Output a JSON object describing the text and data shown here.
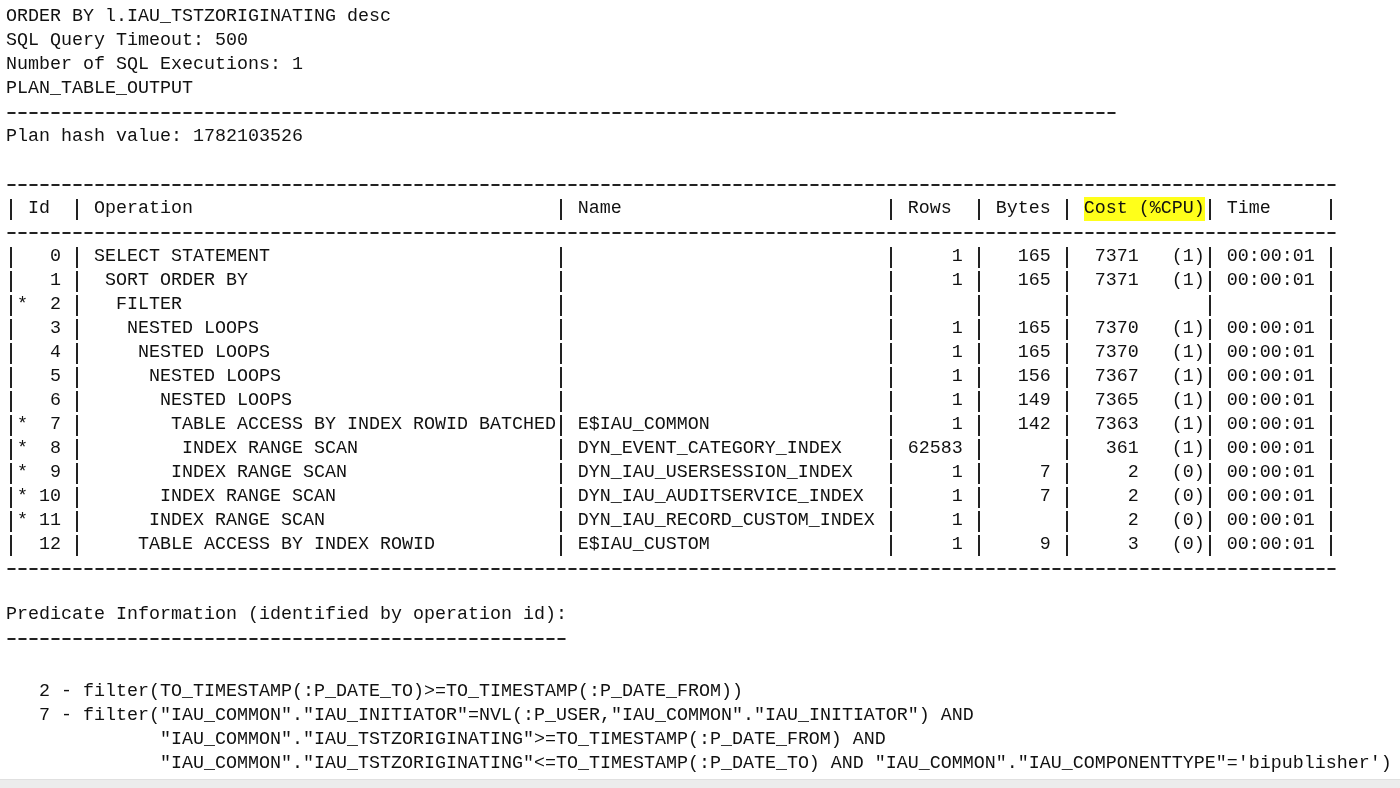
{
  "preamble": [
    "ORDER BY l.IAU_TSTZORIGINATING desc",
    "SQL Query Timeout: 500",
    "Number of SQL Executions: 1",
    "PLAN_TABLE_OUTPUT"
  ],
  "plan_hash": "Plan hash value: 1782103526",
  "plan_table": {
    "columns": [
      {
        "label": "Id",
        "highlighted": false
      },
      {
        "label": "Operation",
        "highlighted": false
      },
      {
        "label": "Name",
        "highlighted": false
      },
      {
        "label": "Rows",
        "highlighted": false
      },
      {
        "label": "Bytes",
        "highlighted": false
      },
      {
        "label": "Cost (%CPU)",
        "highlighted": true
      },
      {
        "label": "Time",
        "highlighted": false
      }
    ],
    "rows": [
      {
        "id": "0",
        "operation": "SELECT STATEMENT",
        "rows": "1",
        "bytes": "165",
        "cost": "7371",
        "cpu": "(1)",
        "time": "00:00:01",
        "children": [
          {
            "id": "1",
            "operation": "SORT ORDER BY",
            "rows": "1",
            "bytes": "165",
            "cost": "7371",
            "cpu": "(1)",
            "time": "00:00:01",
            "children": [
              {
                "id": "2",
                "flag": "*",
                "operation": "FILTER",
                "children": [
                  {
                    "id": "3",
                    "operation": "NESTED LOOPS",
                    "rows": "1",
                    "bytes": "165",
                    "cost": "7370",
                    "cpu": "(1)",
                    "time": "00:00:01",
                    "children": [
                      {
                        "id": "4",
                        "operation": "NESTED LOOPS",
                        "rows": "1",
                        "bytes": "165",
                        "cost": "7370",
                        "cpu": "(1)",
                        "time": "00:00:01",
                        "children": [
                          {
                            "id": "5",
                            "operation": "NESTED LOOPS",
                            "rows": "1",
                            "bytes": "156",
                            "cost": "7367",
                            "cpu": "(1)",
                            "time": "00:00:01",
                            "children": [
                              {
                                "id": "6",
                                "operation": "NESTED LOOPS",
                                "rows": "1",
                                "bytes": "149",
                                "cost": "7365",
                                "cpu": "(1)",
                                "time": "00:00:01",
                                "children": [
                                  {
                                    "id": "7",
                                    "flag": "*",
                                    "operation": "TABLE ACCESS BY INDEX ROWID BATCHED",
                                    "name": "E$IAU_COMMON",
                                    "rows": "1",
                                    "bytes": "142",
                                    "cost": "7363",
                                    "cpu": "(1)",
                                    "time": "00:00:01",
                                    "children": [
                                      {
                                        "id": "8",
                                        "flag": "*",
                                        "operation": "INDEX RANGE SCAN",
                                        "name": "DYN_EVENT_CATEGORY_INDEX",
                                        "rows": "62583",
                                        "cost": "361",
                                        "cpu": "(1)",
                                        "time": "00:00:01"
                                      }
                                    ]
                                  },
                                  {
                                    "id": "9",
                                    "flag": "*",
                                    "operation": "INDEX RANGE SCAN",
                                    "name": "DYN_IAU_USERSESSION_INDEX",
                                    "rows": "1",
                                    "bytes": "7",
                                    "cost": "2",
                                    "cpu": "(0)",
                                    "time": "00:00:01"
                                  }
                                ]
                              },
                              {
                                "id": "10",
                                "flag": "*",
                                "operation": "INDEX RANGE SCAN",
                                "name": "DYN_IAU_AUDITSERVICE_INDEX",
                                "rows": "1",
                                "bytes": "7",
                                "cost": "2",
                                "cpu": "(0)",
                                "time": "00:00:01"
                              }
                            ]
                          },
                          {
                            "id": "11",
                            "flag": "*",
                            "operation": "INDEX RANGE SCAN",
                            "name": "DYN_IAU_RECORD_CUSTOM_INDEX",
                            "rows": "1",
                            "cost": "2",
                            "cpu": "(0)",
                            "time": "00:00:01"
                          }
                        ]
                      },
                      {
                        "id": "12",
                        "operation": "TABLE ACCESS BY INDEX ROWID",
                        "name": "E$IAU_CUSTOM",
                        "rows": "1",
                        "bytes": "9",
                        "cost": "3",
                        "cpu": "(0)",
                        "time": "00:00:01"
                      }
                    ]
                  }
                ]
              }
            ]
          }
        ]
      }
    ]
  },
  "predicate_info": {
    "title": "Predicate Information (identified by operation id):",
    "items": [
      {
        "id": "2 -",
        "lines": [
          "filter(TO_TIMESTAMP(:P_DATE_TO)>=TO_TIMESTAMP(:P_DATE_FROM))"
        ]
      },
      {
        "id": "7 -",
        "lines": [
          "filter(\"IAU_COMMON\".\"IAU_INITIATOR\"=NVL(:P_USER,\"IAU_COMMON\".\"IAU_INITIATOR\") AND",
          "\"IAU_COMMON\".\"IAU_TSTZORIGINATING\">=TO_TIMESTAMP(:P_DATE_FROM) AND",
          "\"IAU_COMMON\".\"IAU_TSTZORIGINATING\"<=TO_TIMESTAMP(:P_DATE_TO) AND \"IAU_COMMON\".\"IAU_COMPONENTTYPE\"='bipublisher')"
        ]
      }
    ]
  }
}
